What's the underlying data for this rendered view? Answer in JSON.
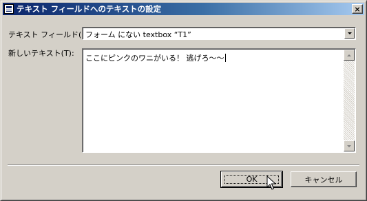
{
  "window": {
    "title": "テキスト フィールドへのテキストの設定",
    "close_glyph": "×"
  },
  "form": {
    "textfield_label": "テキスト フィールド(F):",
    "textfield_value": "フォーム にない textbox “T1”",
    "newtext_label": "新しいテキスト(T):",
    "newtext_value": "ここにピンクのワニがいる！ 逃げろ～～"
  },
  "buttons": {
    "ok_label": "OK",
    "cancel_label": "キャンセル"
  }
}
